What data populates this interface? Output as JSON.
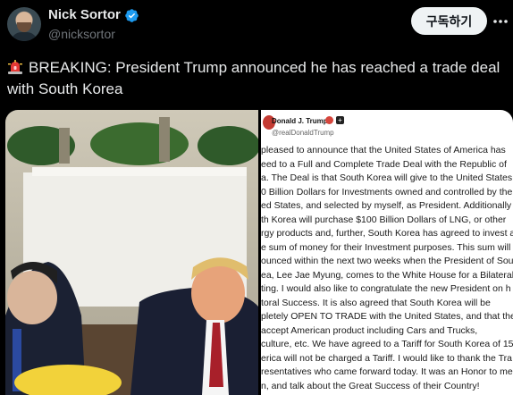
{
  "author": {
    "display_name": "Nick Sortor",
    "handle": "@nicksortor",
    "verified_icon": "verified-badge-icon",
    "avatar": "avatar-photo"
  },
  "actions": {
    "subscribe_label": "구독하기",
    "more_icon": "more-options-icon"
  },
  "tweet": {
    "siren_icon": "police-light-emoji",
    "text": "BREAKING: President Trump announced he has reached a trade deal with South Korea"
  },
  "media": {
    "photo": "Trump and Moon Jae-in shaking hands in the Oval Office",
    "post": {
      "author_name": "Donald J. Trump",
      "author_handle": "@realDonaldTrump",
      "lines": [
        "pleased to announce that the United States of America has",
        "eed to a Full and Complete Trade Deal with the Republic of",
        "a. The Deal is that South Korea will give to the United States",
        "0 Billion Dollars for Investments owned and controlled by the",
        "ed States, and selected by myself, as President. Additionally",
        "th Korea will purchase $100 Billion Dollars of LNG, or other",
        "rgy products and, further, South Korea has agreed to invest a",
        "e sum of money for their Investment purposes. This sum will",
        "ounced within the next two weeks when the President of Sou",
        "ea, Lee Jae Myung, comes to the White House for a Bilateral",
        "ting. I would also like to congratulate the new President on h",
        "toral Success. It is also agreed that South Korea will be",
        "pletely OPEN TO TRADE with the United States, and that the",
        "accept American product including Cars and Trucks,",
        "culture, etc. We have agreed to a Tariff for South Korea of 15",
        "erica will not be charged a Tariff. I would like to thank the Tra",
        "resentatives who came forward today. It was an Honor to me",
        "n, and talk about the Great Success of their Country!"
      ]
    }
  },
  "colors": {
    "background": "#000000",
    "text": "#e7e9ea",
    "secondary_text": "#71767b",
    "verified": "#1d9bf0",
    "button_bg": "#eff3f4"
  }
}
